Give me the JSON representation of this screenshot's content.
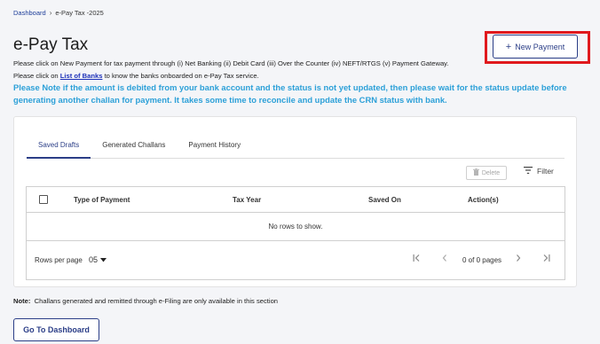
{
  "breadcrumb": {
    "home": "Dashboard",
    "sep": "›",
    "current": "e-Pay Tax -2025"
  },
  "page": {
    "title": "e-Pay Tax",
    "line1": "Please click on New Payment for tax payment through (i) Net Banking (ii) Debit Card (iii) Over the Counter (iv) NEFT/RTGS (v) Payment Gateway.",
    "line2_pre": "Please click on ",
    "line2_link": "List of Banks",
    "line2_post": " to know the banks onboarded on e-Pay Tax service.",
    "note": "Please Note if the amount is debited from your bank account and the status is not yet updated, then please wait for the status update before generating another challan for payment. It takes some time to reconcile and update the CRN status with bank."
  },
  "new_payment": {
    "icon": "+",
    "label": "New Payment"
  },
  "tabs": [
    "Saved Drafts",
    "Generated Challans",
    "Payment History"
  ],
  "toolbar": {
    "delete_label": "Delete",
    "delete_icon": "trash-icon",
    "filter_label": "Filter",
    "filter_icon": "filter-icon"
  },
  "table": {
    "columns": [
      "Type of Payment",
      "Tax Year",
      "Saved On",
      "Action(s)"
    ],
    "empty": "No rows to show."
  },
  "pagination": {
    "rows_label": "Rows per page",
    "page_size": "05",
    "range": "0 of 0 pages"
  },
  "footer": {
    "note_label": "Note:",
    "note_text": "Challans generated and remitted through e-Filing are only available in this section"
  },
  "dashboard_button": "Go To Dashboard",
  "colors": {
    "primary": "#2b3e87",
    "note_blue": "#2ca0d8",
    "highlight": "#e0191d",
    "link": "#1b2fb8"
  }
}
